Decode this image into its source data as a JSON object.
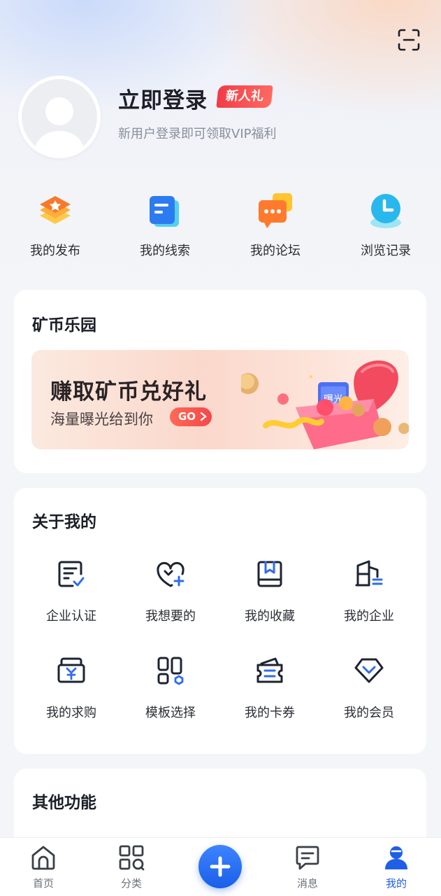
{
  "profile": {
    "login_title": "立即登录",
    "badge": "新人礼",
    "subtitle": "新用户登录即可领取VIP福利",
    "scan_icon": "scan-icon",
    "avatar_icon": "default-avatar-icon"
  },
  "quick_actions": [
    {
      "label": "我的发布",
      "icon": "publish-icon"
    },
    {
      "label": "我的线索",
      "icon": "clue-icon"
    },
    {
      "label": "我的论坛",
      "icon": "forum-icon"
    },
    {
      "label": "浏览记录",
      "icon": "history-clock-icon"
    }
  ],
  "mine_park": {
    "title": "矿币乐园",
    "banner": {
      "title": "赚取矿币兑好礼",
      "subtitle": "海量曝光给到你",
      "go_label": "GO",
      "box_label": "曝光"
    }
  },
  "about_me": {
    "title": "关于我的",
    "items": [
      {
        "label": "企业认证",
        "icon": "certificate-icon"
      },
      {
        "label": "我想要的",
        "icon": "heart-plus-icon"
      },
      {
        "label": "我的收藏",
        "icon": "bookmark-icon"
      },
      {
        "label": "我的企业",
        "icon": "building-icon"
      },
      {
        "label": "我的求购",
        "icon": "purchase-icon"
      },
      {
        "label": "模板选择",
        "icon": "template-icon"
      },
      {
        "label": "我的卡券",
        "icon": "coupon-icon"
      },
      {
        "label": "我的会员",
        "icon": "vip-diamond-icon"
      }
    ]
  },
  "other_functions": {
    "title": "其他功能"
  },
  "tabbar": {
    "items": [
      {
        "label": "首页",
        "icon": "home-icon",
        "active": false
      },
      {
        "label": "分类",
        "icon": "category-icon",
        "active": false
      },
      {
        "label": "消息",
        "icon": "message-icon",
        "active": false
      },
      {
        "label": "我的",
        "icon": "user-icon",
        "active": true
      }
    ],
    "center_icon": "plus-icon"
  },
  "colors": {
    "accent": "#1f5fe6",
    "badge_red": "#f23b45",
    "text_primary": "#1c1f27",
    "text_secondary": "#8a8f99"
  }
}
